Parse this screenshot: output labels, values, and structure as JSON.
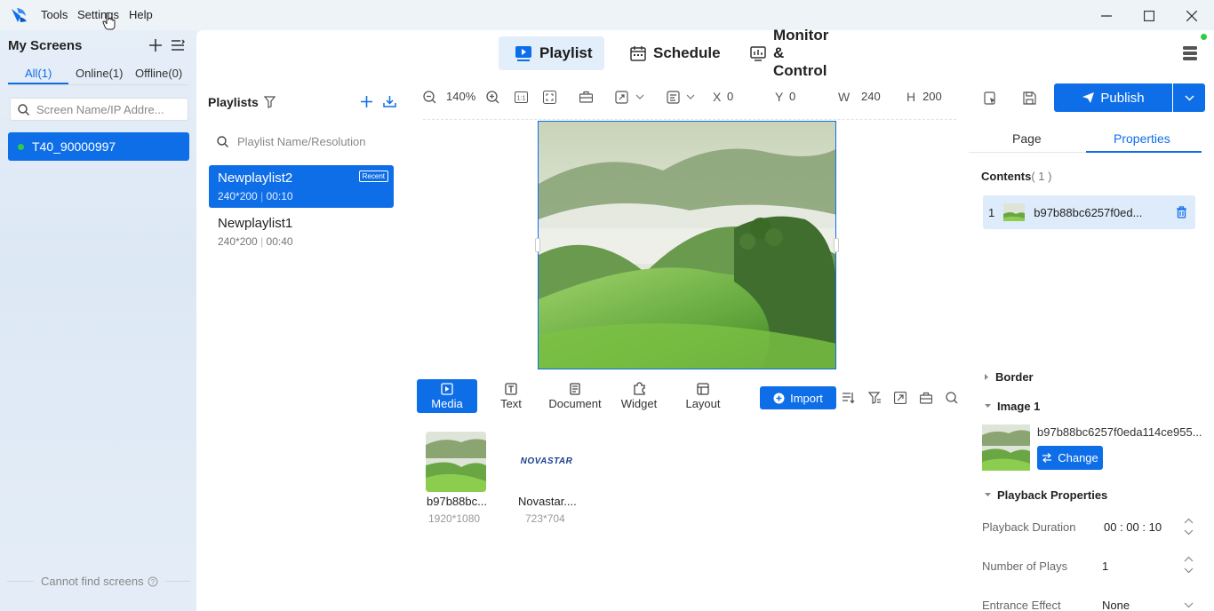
{
  "menubar": {
    "items": [
      "Tools",
      "Settings",
      "Help"
    ]
  },
  "sidebar": {
    "title": "My Screens",
    "filters": [
      "All(1)",
      "Online(1)",
      "Offline(0)"
    ],
    "search_placeholder": "Screen Name/IP Addre...",
    "screens": [
      {
        "name": "T40_90000997",
        "status": "online"
      }
    ],
    "footer": "Cannot find screens"
  },
  "nav": {
    "tabs": [
      "Playlist",
      "Schedule",
      "Monitor & Control"
    ]
  },
  "playlists": {
    "title": "Playlists",
    "search_placeholder": "Playlist Name/Resolution",
    "items": [
      {
        "name": "Newplaylist2",
        "resolution": "240*200",
        "duration": "00:10",
        "badge": "Recent"
      },
      {
        "name": "Newplaylist1",
        "resolution": "240*200",
        "duration": "00:40"
      }
    ]
  },
  "toolbar": {
    "zoom": "140%",
    "x_label": "X",
    "x_value": "0",
    "y_label": "Y",
    "y_value": "0",
    "w_label": "W",
    "w_value": "240",
    "h_label": "H",
    "h_value": "200",
    "publish": "Publish"
  },
  "media": {
    "tabs": [
      "Media",
      "Text",
      "Document",
      "Widget",
      "Layout"
    ],
    "import_label": "Import",
    "items": [
      {
        "name": "b97b88bc...",
        "size": "1920*1080"
      },
      {
        "name": "Novastar....",
        "size": "723*704",
        "logo_text": "NOVASTAR"
      }
    ]
  },
  "properties": {
    "tabs": [
      "Page",
      "Properties"
    ],
    "contents_label": "Contents",
    "contents_count": "( 1 )",
    "content_items": [
      {
        "index": "1",
        "name": "b97b88bc6257f0ed..."
      }
    ],
    "border_label": "Border",
    "image_label": "Image 1",
    "image_name": "b97b88bc6257f0eda114ce955...",
    "change_label": "Change",
    "playback_label": "Playback Properties",
    "duration_label": "Playback Duration",
    "duration_value": "00 : 00 : 10",
    "plays_label": "Number of Plays",
    "plays_value": "1",
    "entrance_label": "Entrance Effect",
    "entrance_value": "None"
  },
  "colors": {
    "accent": "#0e6ee8",
    "online": "#2ecc40"
  }
}
